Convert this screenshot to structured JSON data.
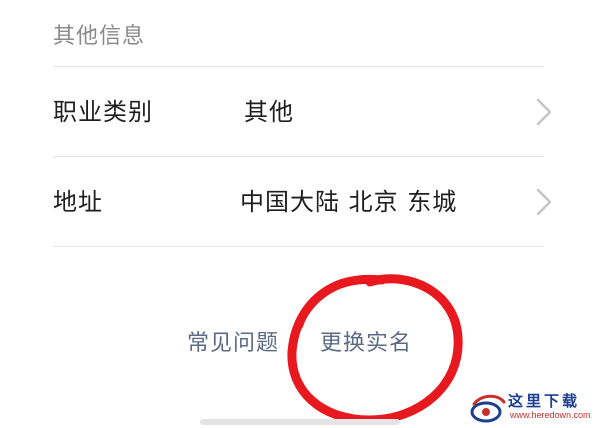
{
  "section": {
    "title": "其他信息"
  },
  "rows": [
    {
      "label": "职业类别",
      "value": "其他"
    },
    {
      "label": "地址",
      "value": "中国大陆 北京 东城"
    }
  ],
  "footer": {
    "faq_label": "常见问题",
    "change_name_label": "更换实名"
  },
  "annotation": {
    "color": "#e8191e"
  },
  "watermark": {
    "text": "这里下载",
    "url": "www.heredown.com"
  },
  "colors": {
    "label": "#1f1f1f",
    "section_title": "#8a8a8a",
    "link": "#5b6b86",
    "divider": "#e6e6e6",
    "chevron": "#c4c4c4"
  }
}
